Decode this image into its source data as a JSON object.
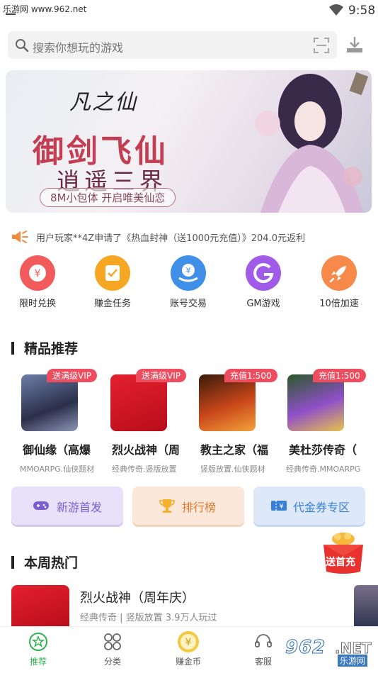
{
  "status_bar": {
    "watermark": "乐游网 www.962.net",
    "time": "9:58"
  },
  "search": {
    "placeholder": "搜索你想玩的游戏"
  },
  "banner": {
    "logo": "凡之仙",
    "headline": "御剑飞仙",
    "subline": "逍遥三界",
    "tagline": "8M小包体  开启唯美仙恋"
  },
  "notice": {
    "text": "用户玩家**4Z申请了《热血封神（送1000元充值）》204.0元返利"
  },
  "quick_actions": [
    {
      "label": "限时兑换",
      "color": "#f25b5b"
    },
    {
      "label": "赚金任务",
      "color": "#f5a623"
    },
    {
      "label": "账号交易",
      "color": "#3f8fe8"
    },
    {
      "label": "GM游戏",
      "color": "#a05be8"
    },
    {
      "label": "10倍加速",
      "color": "#f7894a"
    }
  ],
  "featured": {
    "title": "精品推荐",
    "games": [
      {
        "name": "御仙缘（高爆",
        "tag": "送满级VIP",
        "desc": "MMOARPG.仙侠题材"
      },
      {
        "name": "烈火战神（周",
        "tag": "送满级VIP",
        "desc": "经典传奇.竖版放置"
      },
      {
        "name": "教主之家（福",
        "tag": "充值1:500",
        "desc": "竖版放置.仙侠题材"
      },
      {
        "name": "美杜莎传奇（",
        "tag": "充值1:500",
        "desc": "经典传奇.MMOARPG"
      }
    ]
  },
  "entries": [
    {
      "label": "新游首发",
      "text_color": "#7a5cd6",
      "bg": "#e8e1fa"
    },
    {
      "label": "排行榜",
      "text_color": "#e07a2e",
      "bg": "#fbe8da"
    },
    {
      "label": "代金券专区",
      "text_color": "#3a7fd6",
      "bg": "#dde9f9"
    }
  ],
  "weekly_hot": {
    "title": "本周热门",
    "first_game": {
      "name": "烈火战神（周年庆）",
      "desc": "经典传奇 | 竖版放置 3.9万人玩过"
    }
  },
  "first_pay_badge": "送首充",
  "bottom_nav": [
    {
      "label": "推荐",
      "active": true
    },
    {
      "label": "分类",
      "active": false
    },
    {
      "label": "赚金币",
      "active": false
    },
    {
      "label": "客服",
      "active": false
    }
  ],
  "brand_watermark": {
    "number": "962",
    "suffix": ".NET",
    "sub": "乐游网"
  },
  "colors": {
    "accent_green": "#2fb34f",
    "tag_red": "#ee4d5f"
  }
}
